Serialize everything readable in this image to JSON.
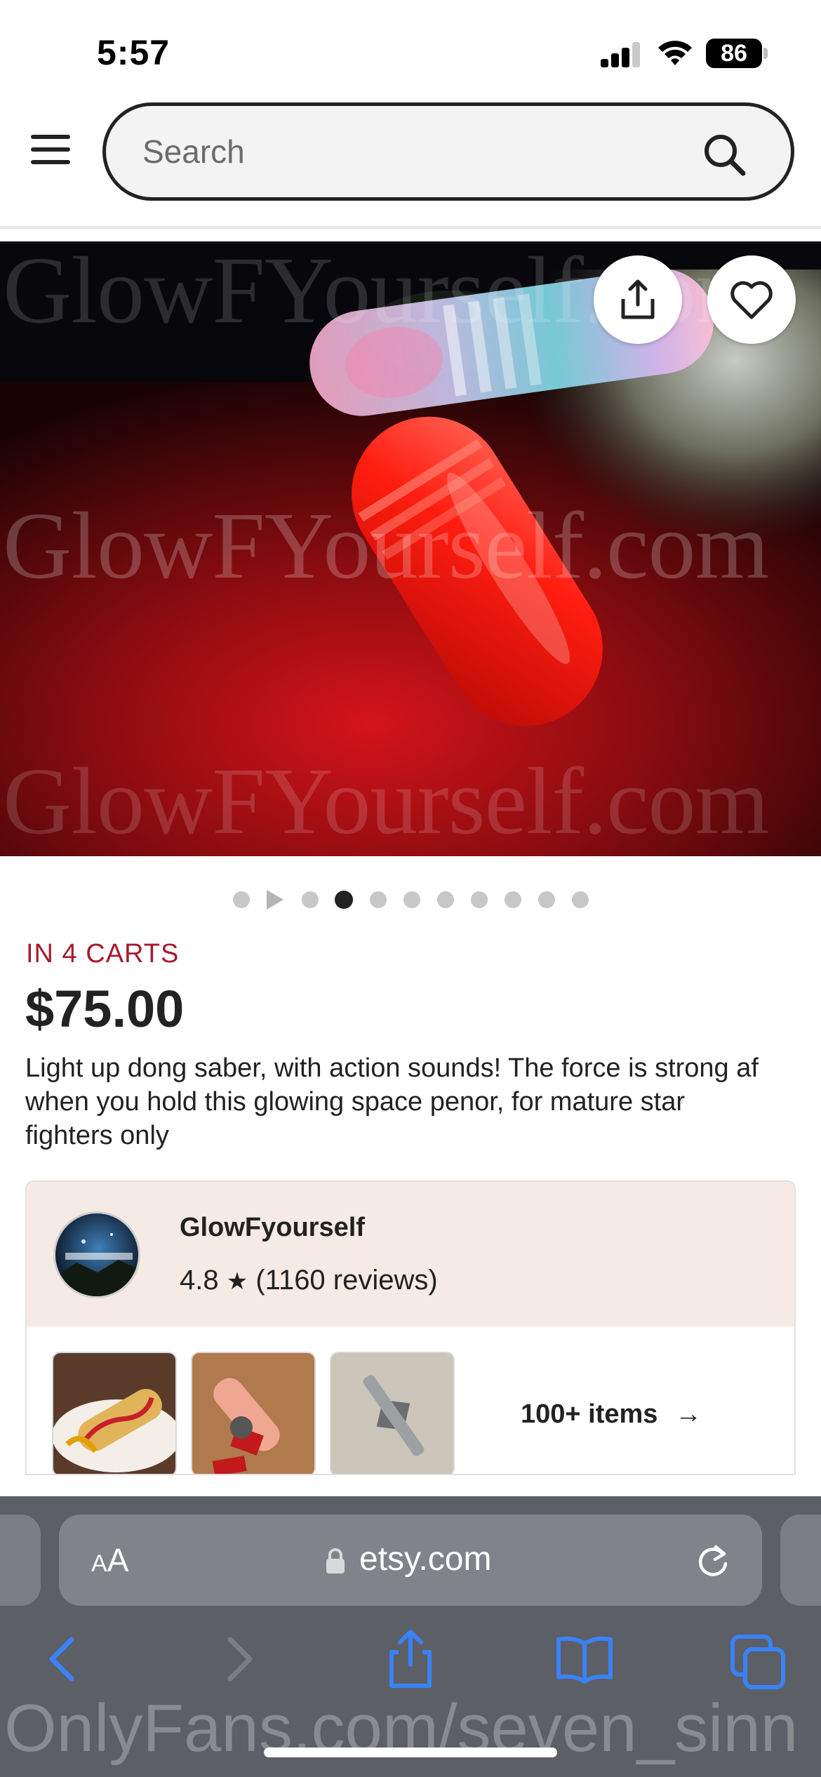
{
  "status_bar": {
    "time": "5:57",
    "battery": "86"
  },
  "header": {
    "search_placeholder": "Search",
    "menu_icon": "hamburger-menu-icon",
    "search_icon": "magnifier-icon"
  },
  "product_image": {
    "watermark_lines": [
      "GlowFYourself.com",
      "GlowFYourself.com",
      "GlowFYourself.com"
    ],
    "share_icon": "share-icon",
    "favorite_icon": "heart-outline-icon",
    "dot_count": 10,
    "active_dot": 3
  },
  "listing": {
    "carts_badge": "IN 4 CARTS",
    "price": "$75.00",
    "description": "Light up dong saber, with action sounds! The force is strong af when you hold this glowing space penor, for mature star fighters only"
  },
  "shop": {
    "name": "GlowFyourself",
    "rating": "4.8",
    "star": "★",
    "reviews": "(1160 reviews)",
    "more_items": "100+ items",
    "arrow": "→"
  },
  "safari": {
    "text_size_label_small": "A",
    "text_size_label_big": "A",
    "url": "etsy.com",
    "overlay_text": "OnlyFans.com/seven_sinn"
  },
  "colors": {
    "accent_red": "#a61a2e",
    "shop_header_bg": "#f5ebe4",
    "safari_bar": "#5c5f66",
    "safari_blue": "#3a82f7"
  }
}
